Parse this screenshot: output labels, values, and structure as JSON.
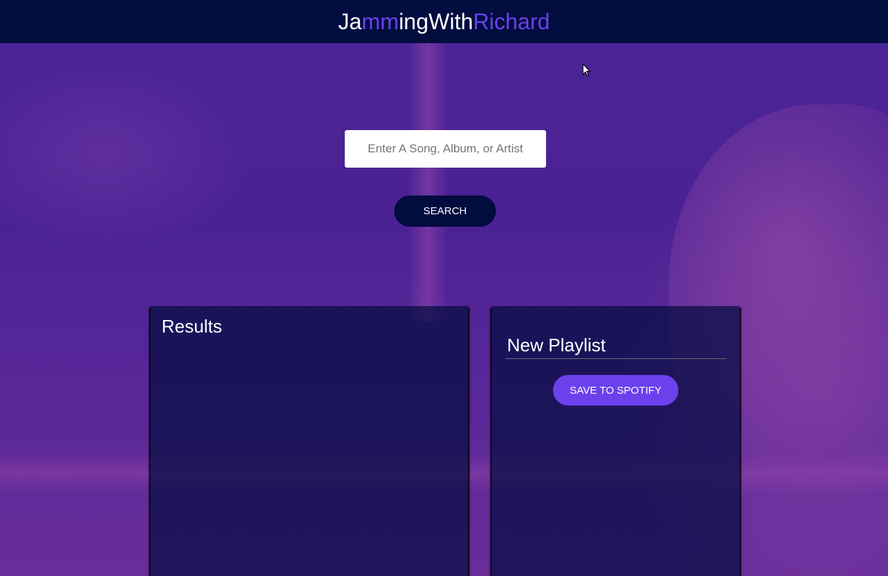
{
  "header": {
    "brand_part1": "Ja",
    "brand_part2": "mm",
    "brand_part3": "ingWith",
    "brand_part4": "Richard"
  },
  "search": {
    "placeholder": "Enter A Song, Album, or Artist",
    "value": "",
    "button_label": "SEARCH"
  },
  "results": {
    "title": "Results",
    "tracks": []
  },
  "playlist": {
    "name": "New Playlist",
    "save_label": "SAVE TO SPOTIFY",
    "tracks": []
  },
  "colors": {
    "header_bg": "#010c3f",
    "accent": "#6c41ec",
    "panel_bg": "#010c3f"
  }
}
